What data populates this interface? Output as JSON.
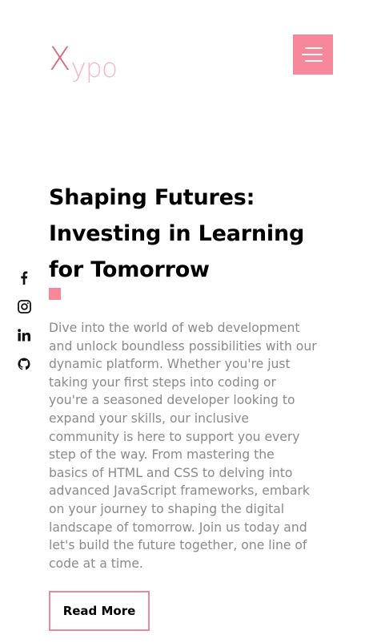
{
  "brand": {
    "logo_initial": "X",
    "logo_rest": "ypo",
    "primary_color": "#f7889c",
    "logo_color_dark": "#d96a83",
    "logo_color_light": "#f7b7c7"
  },
  "header": {
    "menu_icon": "hamburger-icon"
  },
  "social": [
    {
      "name": "facebook",
      "icon": "facebook-icon"
    },
    {
      "name": "instagram",
      "icon": "instagram-icon"
    },
    {
      "name": "linkedin",
      "icon": "linkedin-icon"
    },
    {
      "name": "github",
      "icon": "github-icon"
    }
  ],
  "hero": {
    "title": "Shaping Futures: Investing in Learning for Tomorrow",
    "description": "Dive into the world of web development and unlock boundless possibilities with our dynamic platform. Whether you're just taking your first steps into coding or you're a seasoned developer looking to expand your skills, our inclusive community is here to support you every step of the way. From mastering the basics of HTML and CSS to delving into advanced JavaScript frameworks, embark on your journey to shaping the digital landscape of tomorrow. Join us today and let's build the future together, one line of code at a time.",
    "cta_label": "Read More"
  }
}
